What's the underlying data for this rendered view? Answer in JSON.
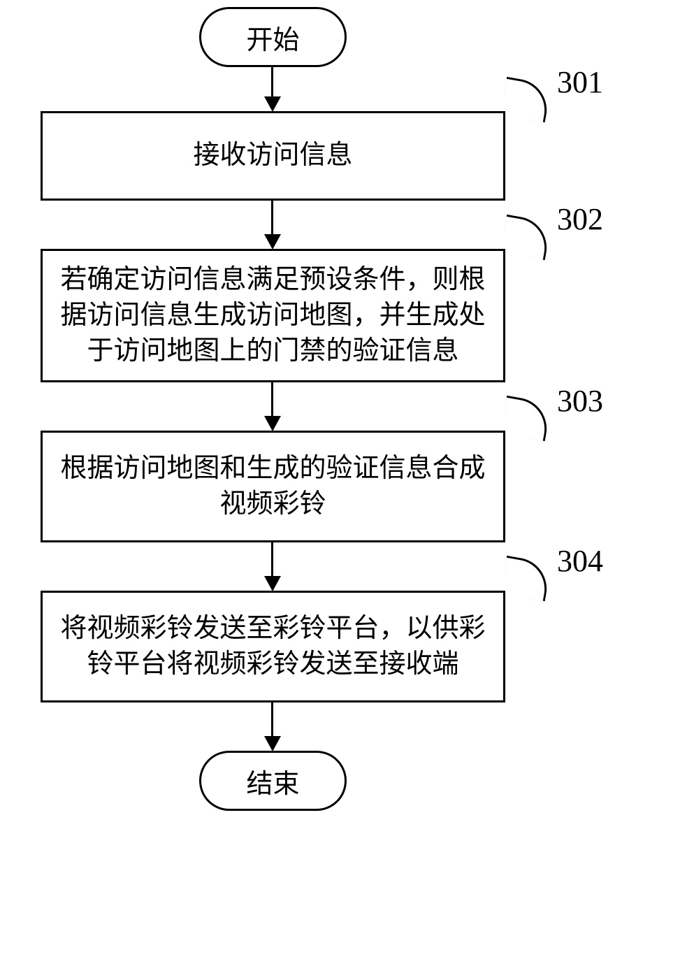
{
  "chart_data": {
    "type": "flowchart",
    "nodes": [
      {
        "id": "start",
        "kind": "terminal",
        "text": "开始"
      },
      {
        "id": "s301",
        "kind": "process",
        "text": "接收访问信息",
        "label": "301"
      },
      {
        "id": "s302",
        "kind": "process",
        "text": "若确定访问信息满足预设条件，则根据访问信息生成访问地图，并生成处于访问地图上的门禁的验证信息",
        "label": "302"
      },
      {
        "id": "s303",
        "kind": "process",
        "text": "根据访问地图和生成的验证信息合成视频彩铃",
        "label": "303"
      },
      {
        "id": "s304",
        "kind": "process",
        "text": "将视频彩铃发送至彩铃平台，以供彩铃平台将视频彩铃发送至接收端",
        "label": "304"
      },
      {
        "id": "end",
        "kind": "terminal",
        "text": "结束"
      }
    ],
    "edges": [
      [
        "start",
        "s301"
      ],
      [
        "s301",
        "s302"
      ],
      [
        "s302",
        "s303"
      ],
      [
        "s303",
        "s304"
      ],
      [
        "s304",
        "end"
      ]
    ]
  },
  "start": {
    "text": "开始"
  },
  "end": {
    "text": "结束"
  },
  "step301": {
    "text": "接收访问信息",
    "label": "301"
  },
  "step302": {
    "text": "若确定访问信息满足预设条件，则根\n据访问信息生成访问地图，并生成处\n于访问地图上的门禁的验证信息",
    "label": "302"
  },
  "step303": {
    "text": "根据访问地图和生成的验证信息合成\n视频彩铃",
    "label": "303"
  },
  "step304": {
    "text": "将视频彩铃发送至彩铃平台，以供彩\n铃平台将视频彩铃发送至接收端",
    "label": "304"
  }
}
